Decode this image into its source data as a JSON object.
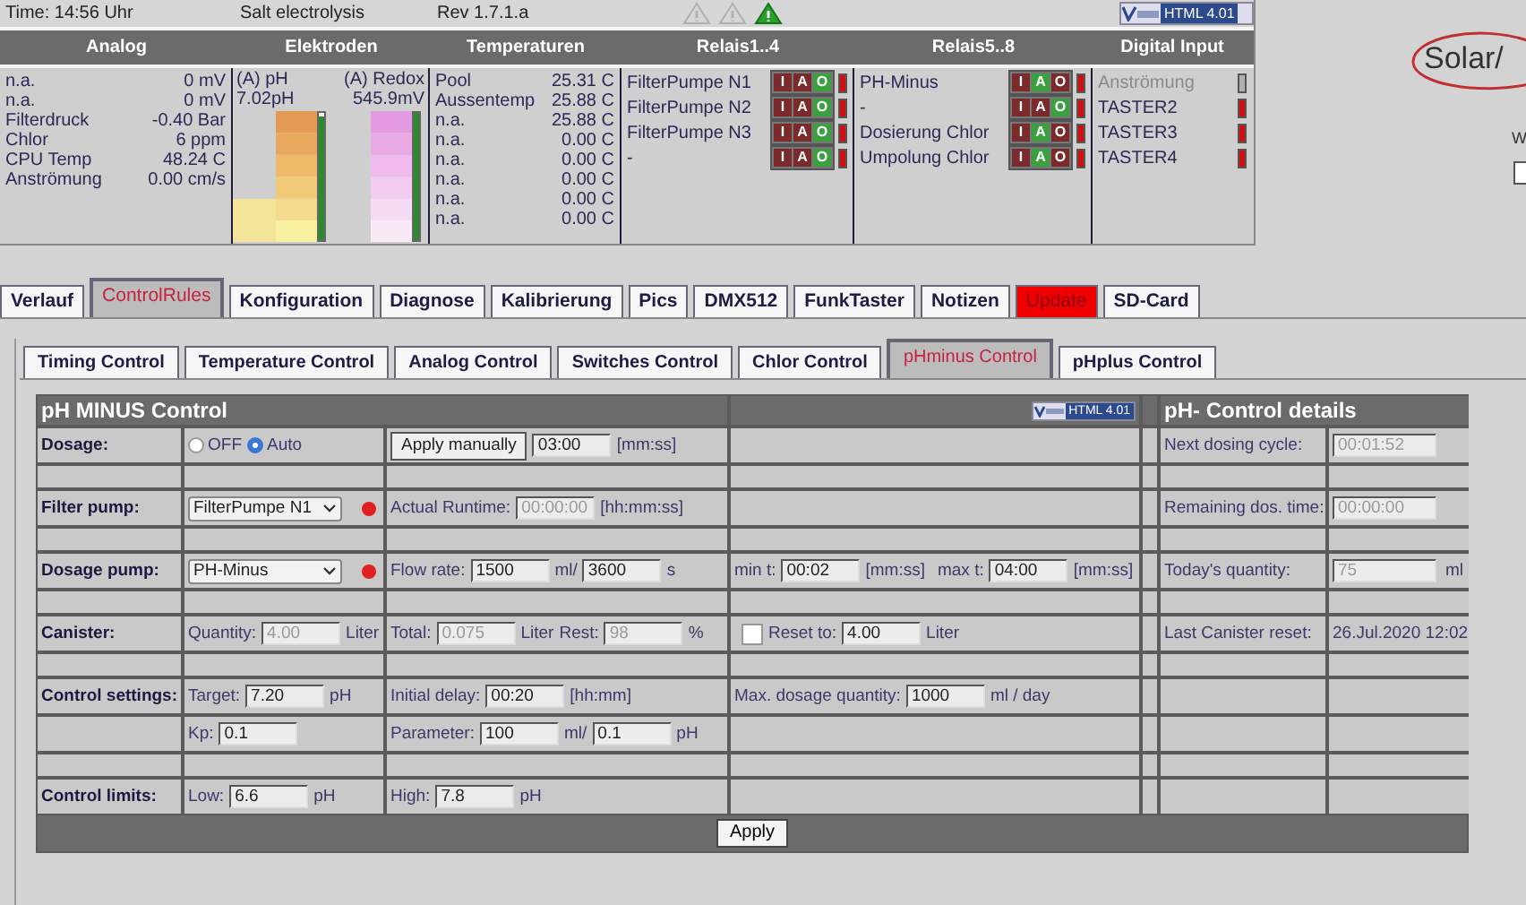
{
  "status": {
    "time": "Time: 14:56 Uhr",
    "title": "Salt electrolysis",
    "revision": "Rev 1.7.1.a",
    "warnings": [
      {
        "active": false
      },
      {
        "active": false
      },
      {
        "active": true
      }
    ],
    "badge": "HTML 4.01"
  },
  "overview": {
    "columns": [
      "Analog",
      "Elektroden",
      "Temperaturen",
      "Relais1..4",
      "Relais5..8",
      "Digital Input"
    ],
    "analog": [
      {
        "name": "n.a.",
        "value": "0 mV"
      },
      {
        "name": "n.a.",
        "value": "0 mV"
      },
      {
        "name": "Filterdruck",
        "value": "-0.40 Bar"
      },
      {
        "name": "Chlor",
        "value": "6 ppm"
      },
      {
        "name": "CPU Temp",
        "value": "48.24 C"
      },
      {
        "name": "Anströmung",
        "value": "0.00 cm/s"
      }
    ],
    "electrodes": [
      {
        "kind": "ph",
        "label": "(A) pH",
        "reading": "7.02pH",
        "level": 0.97
      },
      {
        "kind": "redox",
        "label": "(A) Redox",
        "reading": "545.9mV",
        "level": 1
      }
    ],
    "temperatures": [
      {
        "name": "Pool",
        "value": "25.31 C"
      },
      {
        "name": "Aussentemp",
        "value": "25.88 C"
      },
      {
        "name": "n.a.",
        "value": "25.88 C"
      },
      {
        "name": "n.a.",
        "value": "0.00 C"
      },
      {
        "name": "n.a.",
        "value": "0.00 C"
      },
      {
        "name": "n.a.",
        "value": "0.00 C"
      },
      {
        "name": "n.a.",
        "value": "0.00 C"
      },
      {
        "name": "n.a.",
        "value": "0.00 C"
      }
    ],
    "relays_1_4": [
      {
        "name": "FilterPumpe N1",
        "on": false,
        "modes": [
          {
            "label": "I",
            "selected": false
          },
          {
            "label": "A",
            "selected": false
          },
          {
            "label": "O",
            "selected": true
          }
        ]
      },
      {
        "name": "FilterPumpe N2",
        "on": false,
        "modes": [
          {
            "label": "I",
            "selected": false
          },
          {
            "label": "A",
            "selected": false
          },
          {
            "label": "O",
            "selected": true
          }
        ]
      },
      {
        "name": "FilterPumpe N3",
        "on": false,
        "modes": [
          {
            "label": "I",
            "selected": false
          },
          {
            "label": "A",
            "selected": false
          },
          {
            "label": "O",
            "selected": true
          }
        ]
      },
      {
        "name": "-",
        "on": false,
        "modes": [
          {
            "label": "I",
            "selected": false
          },
          {
            "label": "A",
            "selected": false
          },
          {
            "label": "O",
            "selected": true
          }
        ]
      }
    ],
    "relays_5_8": [
      {
        "name": "PH-Minus",
        "on": false,
        "modes": [
          {
            "label": "I",
            "selected": false
          },
          {
            "label": "A",
            "selected": true
          },
          {
            "label": "O",
            "selected": false
          }
        ]
      },
      {
        "name": "-",
        "on": false,
        "modes": [
          {
            "label": "I",
            "selected": false
          },
          {
            "label": "A",
            "selected": false
          },
          {
            "label": "O",
            "selected": true
          }
        ]
      },
      {
        "name": "Dosierung Chlor",
        "on": false,
        "modes": [
          {
            "label": "I",
            "selected": false
          },
          {
            "label": "A",
            "selected": true
          },
          {
            "label": "O",
            "selected": false
          }
        ]
      },
      {
        "name": "Umpolung Chlor",
        "on": false,
        "modes": [
          {
            "label": "I",
            "selected": false
          },
          {
            "label": "A",
            "selected": true
          },
          {
            "label": "O",
            "selected": false
          }
        ]
      }
    ],
    "digital_inputs": [
      {
        "name": "Anströmung",
        "disabled": true,
        "active": false
      },
      {
        "name": "TASTER2",
        "disabled": false,
        "active": false
      },
      {
        "name": "TASTER3",
        "disabled": false,
        "active": false
      },
      {
        "name": "TASTER4",
        "disabled": false,
        "active": false
      }
    ]
  },
  "brand": {
    "logo": "Solar/",
    "side_label": "W",
    "side_checkbox": {
      "checked": false
    }
  },
  "tabs": [
    {
      "label": "Verlauf",
      "selected": false,
      "kind": "normal"
    },
    {
      "label": "ControlRules",
      "selected": true,
      "kind": "normal"
    },
    {
      "label": "Konfiguration",
      "selected": false,
      "kind": "normal"
    },
    {
      "label": "Diagnose",
      "selected": false,
      "kind": "normal"
    },
    {
      "label": "Kalibrierung",
      "selected": false,
      "kind": "normal"
    },
    {
      "label": "Pics",
      "selected": false,
      "kind": "normal"
    },
    {
      "label": "DMX512",
      "selected": false,
      "kind": "normal"
    },
    {
      "label": "FunkTaster",
      "selected": false,
      "kind": "normal"
    },
    {
      "label": "Notizen",
      "selected": false,
      "kind": "normal"
    },
    {
      "label": "Update",
      "selected": false,
      "kind": "alert"
    },
    {
      "label": "SD-Card",
      "selected": false,
      "kind": "normal"
    }
  ],
  "subtabs": [
    {
      "label": "Timing Control",
      "selected": false,
      "kind": "normal"
    },
    {
      "label": "Temperature Control",
      "selected": false,
      "kind": "normal"
    },
    {
      "label": "Analog Control",
      "selected": false,
      "kind": "normal"
    },
    {
      "label": "Switches Control",
      "selected": false,
      "kind": "normal"
    },
    {
      "label": "Chlor Control",
      "selected": false,
      "kind": "normal"
    },
    {
      "label": "pHminus Control",
      "selected": true,
      "kind": "normal"
    },
    {
      "label": "pHplus Control",
      "selected": false,
      "kind": "normal"
    }
  ],
  "control": {
    "title": "pH MINUS Control",
    "badge": "HTML 4.01",
    "details_title": "pH- Control details",
    "apply": "Apply",
    "groups": [
      {
        "rows": [
          {
            "label": "Dosage:",
            "cells": [
              [
                {
                  "kind": "radio",
                  "label": "OFF",
                  "selected": false
                },
                {
                  "kind": "radio",
                  "label": "Auto",
                  "selected": true
                }
              ],
              [
                {
                  "kind": "button",
                  "label": "Apply manually"
                },
                {
                  "kind": "input",
                  "value": "03:00",
                  "disabled": false
                },
                {
                  "kind": "text",
                  "text": "[mm:ss]"
                }
              ],
              []
            ],
            "detail": {
              "kind": "field",
              "label": "Next dosing cycle:",
              "value": "00:01:52"
            }
          }
        ]
      },
      {
        "rows": [
          {
            "label": "Filter pump:",
            "cells": [
              [
                {
                  "kind": "select",
                  "value": "FilterPumpe N1"
                },
                {
                  "kind": "led",
                  "on": false
                }
              ],
              [
                {
                  "kind": "text",
                  "text": "Actual Runtime:"
                },
                {
                  "kind": "input",
                  "value": "00:00:00",
                  "disabled": true
                },
                {
                  "kind": "text",
                  "text": "[hh:mm:ss]"
                }
              ],
              []
            ],
            "detail": {
              "kind": "field",
              "label": "Remaining dos. time:",
              "value": "00:00:00"
            }
          }
        ]
      },
      {
        "rows": [
          {
            "label": "Dosage pump:",
            "cells": [
              [
                {
                  "kind": "select",
                  "value": "PH-Minus"
                },
                {
                  "kind": "led",
                  "on": false
                }
              ],
              [
                {
                  "kind": "text",
                  "text": "Flow rate:"
                },
                {
                  "kind": "input",
                  "value": "1500",
                  "disabled": false
                },
                {
                  "kind": "text",
                  "text": "ml/"
                },
                {
                  "kind": "input",
                  "value": "3600",
                  "disabled": false
                },
                {
                  "kind": "text",
                  "text": "s"
                }
              ],
              [
                {
                  "kind": "text",
                  "text": "min t:"
                },
                {
                  "kind": "input",
                  "value": "00:02",
                  "disabled": false
                },
                {
                  "kind": "text",
                  "text": "[mm:ss]"
                },
                {
                  "kind": "text",
                  "text": "max t:"
                },
                {
                  "kind": "input",
                  "value": "04:00",
                  "disabled": false
                },
                {
                  "kind": "text",
                  "text": "[mm:ss]"
                }
              ]
            ],
            "detail": {
              "kind": "field",
              "label": "Today's quantity:",
              "value": "75",
              "unit": "ml"
            }
          }
        ]
      },
      {
        "rows": [
          {
            "label": "Canister:",
            "cells": [
              [
                {
                  "kind": "text",
                  "text": "Quantity:"
                },
                {
                  "kind": "input",
                  "value": "4.00",
                  "disabled": true
                },
                {
                  "kind": "text",
                  "text": "Liter"
                }
              ],
              [
                {
                  "kind": "text",
                  "text": "Total:"
                },
                {
                  "kind": "input",
                  "value": "0.075",
                  "disabled": true
                },
                {
                  "kind": "text",
                  "text": "Liter"
                },
                {
                  "kind": "text",
                  "text": "Rest:"
                },
                {
                  "kind": "input",
                  "value": "98",
                  "disabled": true
                },
                {
                  "kind": "text",
                  "text": "%"
                }
              ],
              [
                {
                  "kind": "checkbox",
                  "checked": false
                },
                {
                  "kind": "text",
                  "text": "Reset to:"
                },
                {
                  "kind": "input",
                  "value": "4.00",
                  "disabled": false
                },
                {
                  "kind": "text",
                  "text": "Liter"
                }
              ]
            ],
            "detail": {
              "kind": "text",
              "label": "Last Canister reset:",
              "value": "26.Jul.2020 12:02"
            }
          }
        ]
      },
      {
        "rows": [
          {
            "label": "Control settings:",
            "cells": [
              [
                {
                  "kind": "text",
                  "text": "Target:"
                },
                {
                  "kind": "input",
                  "value": "7.20",
                  "disabled": false
                },
                {
                  "kind": "text",
                  "text": "pH"
                }
              ],
              [
                {
                  "kind": "text",
                  "text": "Initial delay:"
                },
                {
                  "kind": "input",
                  "value": "00:20",
                  "disabled": false
                },
                {
                  "kind": "text",
                  "text": "[hh:mm]"
                }
              ],
              [
                {
                  "kind": "text",
                  "text": "Max. dosage quantity:"
                },
                {
                  "kind": "input",
                  "value": "1000",
                  "disabled": false
                },
                {
                  "kind": "text",
                  "text": "ml / day"
                }
              ]
            ]
          },
          {
            "cells": [
              [
                {
                  "kind": "text",
                  "text": "Kp:"
                },
                {
                  "kind": "input",
                  "value": "0.1",
                  "disabled": false
                }
              ],
              [
                {
                  "kind": "text",
                  "text": "Parameter:"
                },
                {
                  "kind": "input",
                  "value": "100",
                  "disabled": false
                },
                {
                  "kind": "text",
                  "text": "ml/"
                },
                {
                  "kind": "input",
                  "value": "0.1",
                  "disabled": false
                },
                {
                  "kind": "text",
                  "text": "pH"
                }
              ],
              []
            ]
          }
        ]
      },
      {
        "rows": [
          {
            "label": "Control limits:",
            "cells": [
              [
                {
                  "kind": "text",
                  "text": "Low:"
                },
                {
                  "kind": "input",
                  "value": "6.6",
                  "disabled": false
                },
                {
                  "kind": "text",
                  "text": "pH"
                }
              ],
              [
                {
                  "kind": "text",
                  "text": "High:"
                },
                {
                  "kind": "input",
                  "value": "7.8",
                  "disabled": false
                },
                {
                  "kind": "text",
                  "text": "pH"
                }
              ],
              []
            ]
          }
        ]
      }
    ]
  }
}
